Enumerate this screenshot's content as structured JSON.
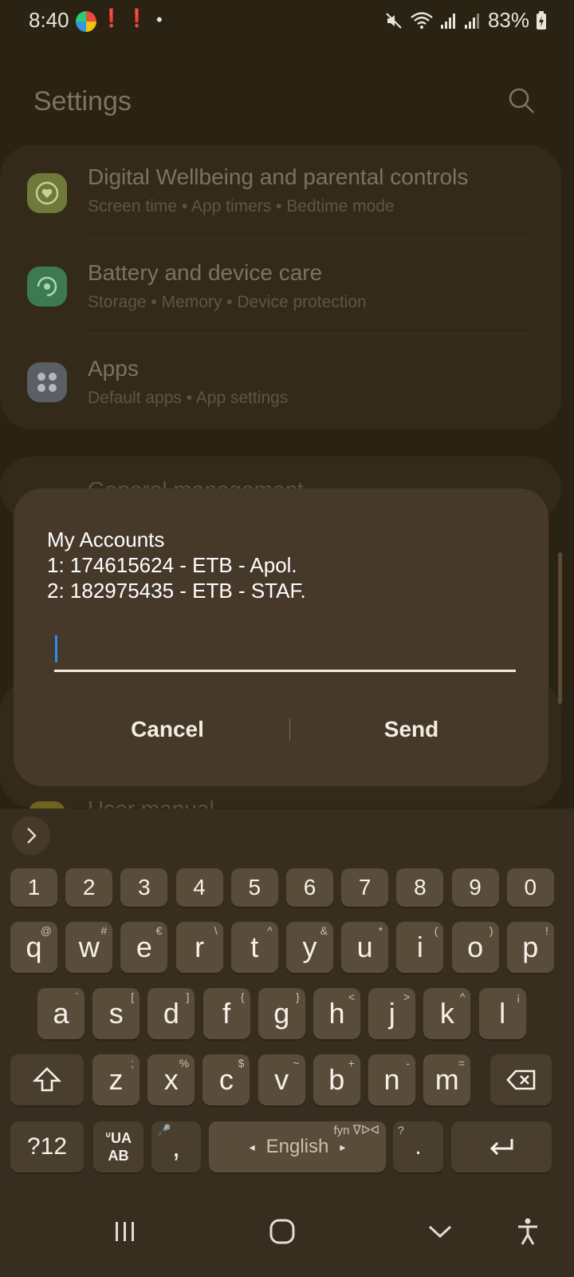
{
  "status_bar": {
    "time": "8:40",
    "battery": "83%"
  },
  "settings": {
    "title": "Settings",
    "items": [
      {
        "title": "Digital Wellbeing and parental controls",
        "subtitle": "Screen time  •  App timers  •  Bedtime mode",
        "icon": "heart-icon",
        "icon_color": "#6f7a3a"
      },
      {
        "title": "Battery and device care",
        "subtitle": "Storage  •  Memory  •  Device protection",
        "icon": "refresh-icon",
        "icon_color": "#3c7a52"
      },
      {
        "title": "Apps",
        "subtitle": "Default apps  •  App settings",
        "icon": "apps-grid-icon",
        "icon_color": "#5a5f66"
      }
    ],
    "partial_item_top": "General management",
    "partial_item_bottom": "User manual"
  },
  "dialog": {
    "message_line1": "My Accounts",
    "message_line2": "1: 174615624 - ETB - Apol.",
    "message_line3": "2: 182975435 - ETB - STAF.",
    "input_value": "",
    "cancel_label": "Cancel",
    "send_label": "Send"
  },
  "keyboard": {
    "number_row": [
      "1",
      "2",
      "3",
      "4",
      "5",
      "6",
      "7",
      "8",
      "9",
      "0"
    ],
    "row1": [
      {
        "k": "q",
        "s": "@"
      },
      {
        "k": "w",
        "s": "#"
      },
      {
        "k": "e",
        "s": "€"
      },
      {
        "k": "r",
        "s": "\\"
      },
      {
        "k": "t",
        "s": "^"
      },
      {
        "k": "y",
        "s": "&"
      },
      {
        "k": "u",
        "s": "*"
      },
      {
        "k": "i",
        "s": "("
      },
      {
        "k": "o",
        "s": ")"
      },
      {
        "k": "p",
        "s": "!"
      }
    ],
    "row2": [
      {
        "k": "a",
        "s": "`"
      },
      {
        "k": "s",
        "s": "["
      },
      {
        "k": "d",
        "s": "]"
      },
      {
        "k": "f",
        "s": "{"
      },
      {
        "k": "g",
        "s": "}"
      },
      {
        "k": "h",
        "s": "<"
      },
      {
        "k": "j",
        "s": ">"
      },
      {
        "k": "k",
        "s": "^"
      },
      {
        "k": "l",
        "s": "¡"
      }
    ],
    "row3": [
      {
        "k": "z",
        "s": ";"
      },
      {
        "k": "x",
        "s": "%"
      },
      {
        "k": "c",
        "s": "$"
      },
      {
        "k": "v",
        "s": "~"
      },
      {
        "k": "b",
        "s": "+"
      },
      {
        "k": "n",
        "s": "-"
      },
      {
        "k": "m",
        "s": "="
      }
    ],
    "symbols_label": "?12",
    "lang_switch_top": "ᐡUA",
    "lang_switch_bottom": "AB",
    "comma_label": ",",
    "space_label": "English",
    "space_hint": "fyn ᐁᐅᐊ",
    "period_label": ".",
    "period_hint": "?"
  }
}
